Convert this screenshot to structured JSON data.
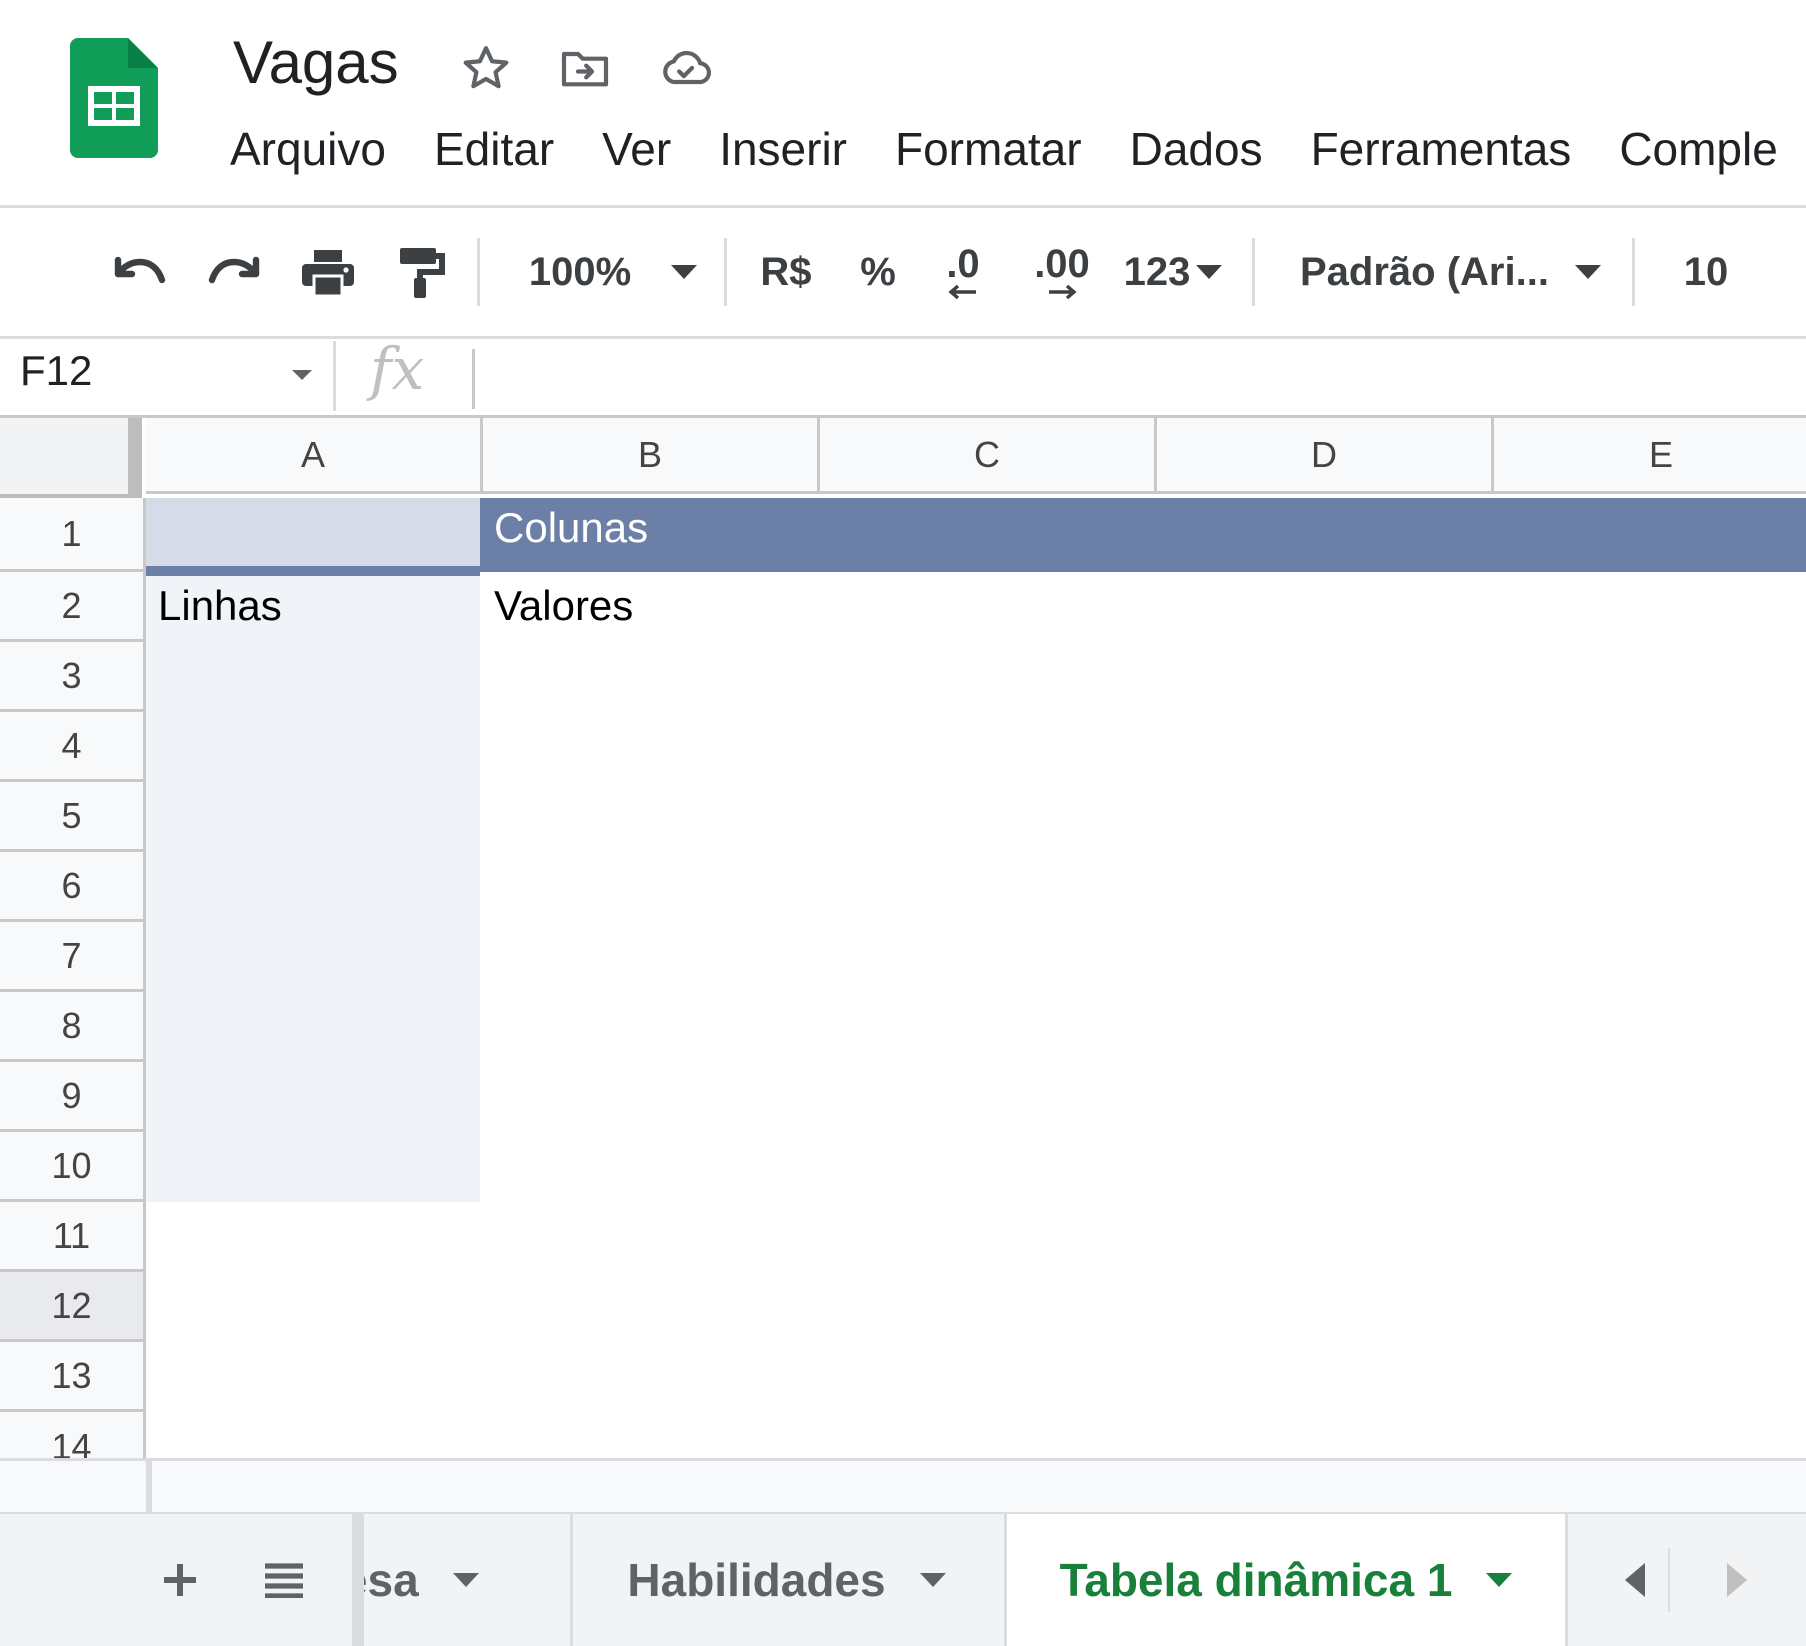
{
  "app": {
    "doc_title": "Vagas",
    "menu": [
      "Arquivo",
      "Editar",
      "Ver",
      "Inserir",
      "Formatar",
      "Dados",
      "Ferramentas",
      "Comple"
    ]
  },
  "toolbar": {
    "zoom": "100%",
    "currency": "R$",
    "percent": "%",
    "dec_decrease": ".0",
    "dec_increase": ".00",
    "number_format": "123",
    "font_family": "Padrão (Ari...",
    "font_size": "10"
  },
  "formula_bar": {
    "name_box": "F12",
    "fx": "fx",
    "value": ""
  },
  "grid": {
    "columns": [
      "A",
      "B",
      "C",
      "D",
      "E"
    ],
    "rows": [
      "1",
      "2",
      "3",
      "4",
      "5",
      "6",
      "7",
      "8",
      "9",
      "10",
      "11",
      "12",
      "13",
      "14"
    ],
    "selected_row": "12",
    "cells": {
      "B1": "Colunas",
      "A2": "Linhas",
      "B2": "Valores"
    },
    "colors": {
      "header_band": "#6c7fa6",
      "row_band": "#f0f3f7",
      "a1_band": "#d5dbe7"
    }
  },
  "sheets": {
    "tabs": [
      {
        "label": "resa",
        "active": false
      },
      {
        "label": "Habilidades",
        "active": false
      },
      {
        "label": "Tabela dinâmica 1",
        "active": true
      }
    ],
    "active_color": "#188038"
  },
  "icons": [
    "sheets-logo-icon",
    "star-icon",
    "move-to-folder-icon",
    "cloud-saved-icon",
    "undo-icon",
    "redo-icon",
    "print-icon",
    "paint-format-icon",
    "add-sheet-icon",
    "all-sheets-icon",
    "scroll-left-icon",
    "scroll-right-icon"
  ]
}
